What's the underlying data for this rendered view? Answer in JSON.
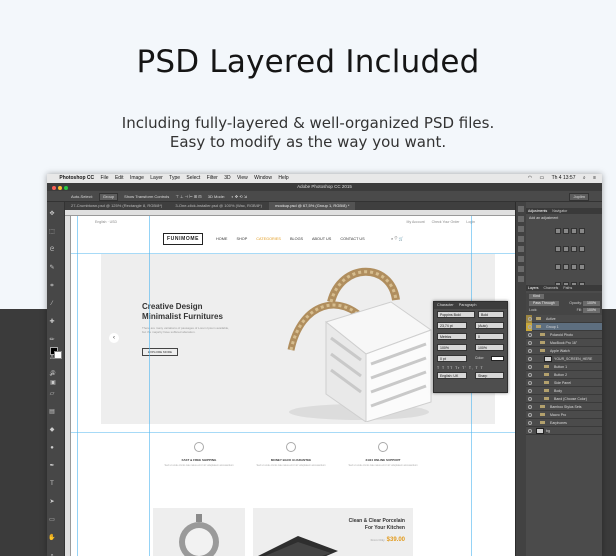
{
  "heading": "PSD Layered Included",
  "subtitle": {
    "line1": "Including fully-layered & well-organized PSD files.",
    "line2": "Easy to modify as the way you want."
  },
  "mac_menu": {
    "apple": "",
    "app": "Photoshop CC",
    "items": [
      "File",
      "Edit",
      "Image",
      "Layer",
      "Type",
      "Select",
      "Filter",
      "3D",
      "View",
      "Window",
      "Help"
    ],
    "clock": "Th 4 13:57"
  },
  "window_title": "Adobe Photoshop CC 2015",
  "options_bar": {
    "auto_select": "Auto-Select:",
    "group": "Group",
    "show_transform": "Show Transform Controls",
    "mode_3d": "3D Mode:",
    "workspace": "Joplim"
  },
  "doc_tabs": [
    "27-Crumbtown.psd @ 125% (Rectangle 8, RGB/8*)",
    "3-One-click-installer.psd @ 100% (Wac, RGB/8*)",
    "mockup.psd @ 67,5% (Group 1, RGB/8) *"
  ],
  "site": {
    "top_left": "English  ·  USD",
    "top_right": [
      "My Account",
      "Check Your Order",
      "Login"
    ],
    "logo": "FUNIMOME",
    "nav": [
      "HOME",
      "SHOP",
      "CATEGORIES",
      "BLOGS",
      "ABOUT US",
      "CONTACT US"
    ],
    "nav_current_index": 2,
    "nav_icons": "⌕  ♡  🛒",
    "banner_title_1": "Creative Design",
    "banner_title_2": "Minimalist Furnitures",
    "banner_text": "There are many variations of passages of Lorem Ipsum available, but the majority have suffered alteration.",
    "banner_button": "EXPLORE MORE",
    "features": [
      {
        "title": "FAST & FREE SHIPPING",
        "desc": "Sed ut unde omnis iste natus error sit voluptatem accusantium"
      },
      {
        "title": "MONEY BACK GUARANTEE",
        "desc": "Sed ut unde omnis iste natus error sit voluptatem accusantium"
      },
      {
        "title": "24/24 ONLINE SUPPORT",
        "desc": "Sed ut unde omnis iste natus error sit voluptatem accusantium"
      }
    ],
    "product_title_1": "Clean & Clear Porcelain",
    "product_title_2": "For Your Kitchen",
    "product_price_label": "From Only",
    "product_price": "$39.00"
  },
  "character_panel": {
    "tabs": [
      "Character",
      "Paragraph"
    ],
    "font": "Poppins Bold",
    "style": "Bold",
    "size": "23,74 pt",
    "leading": "(Auto)",
    "kerning": "Metrics",
    "tracking": "0",
    "vscale": "100%",
    "hscale": "100%",
    "baseline": "0 pt",
    "color_label": "Color:",
    "style_buttons": "T T TT Tr T' T, T T",
    "language": "English: UK",
    "aa": "Sharp"
  },
  "right_panels": {
    "adj_tabs": [
      "Adjustments",
      "Navigator"
    ],
    "adj_label": "Add an adjustment",
    "layer_tabs": [
      "Layers",
      "Channels",
      "Paths"
    ],
    "kind": "Kind",
    "blend": "Pass Through",
    "opacity_label": "Opacity:",
    "opacity": "100%",
    "lock_label": "Lock:",
    "fill_label": "Fill:",
    "fill": "100%"
  },
  "layers": [
    {
      "name": "Active",
      "type": "folder",
      "indent": 0,
      "selected": false
    },
    {
      "name": "Group 1",
      "type": "folder",
      "indent": 0,
      "selected": true
    },
    {
      "name": "Polaroid Photo",
      "type": "folder",
      "indent": 1,
      "selected": false
    },
    {
      "name": "MacBook Pro 16\"",
      "type": "folder",
      "indent": 1,
      "selected": false
    },
    {
      "name": "Apple Watch",
      "type": "folder",
      "indent": 1,
      "selected": false
    },
    {
      "name": "YOUR_SCREEN_HERE",
      "type": "smart",
      "indent": 2,
      "selected": false
    },
    {
      "name": "Button 1",
      "type": "folder",
      "indent": 2,
      "selected": false
    },
    {
      "name": "Button 2",
      "type": "folder",
      "indent": 2,
      "selected": false
    },
    {
      "name": "Side Panel",
      "type": "folder",
      "indent": 2,
      "selected": false
    },
    {
      "name": "Body",
      "type": "folder",
      "indent": 2,
      "selected": false
    },
    {
      "name": "Band (Choose Color)",
      "type": "folder",
      "indent": 2,
      "selected": false
    },
    {
      "name": "Bamboo Stylus Sets",
      "type": "folder",
      "indent": 1,
      "selected": false
    },
    {
      "name": "Macro Pro",
      "type": "folder",
      "indent": 1,
      "selected": false
    },
    {
      "name": "Earphones",
      "type": "folder",
      "indent": 1,
      "selected": false
    },
    {
      "name": "bg",
      "type": "layer",
      "indent": 0,
      "selected": false
    }
  ]
}
